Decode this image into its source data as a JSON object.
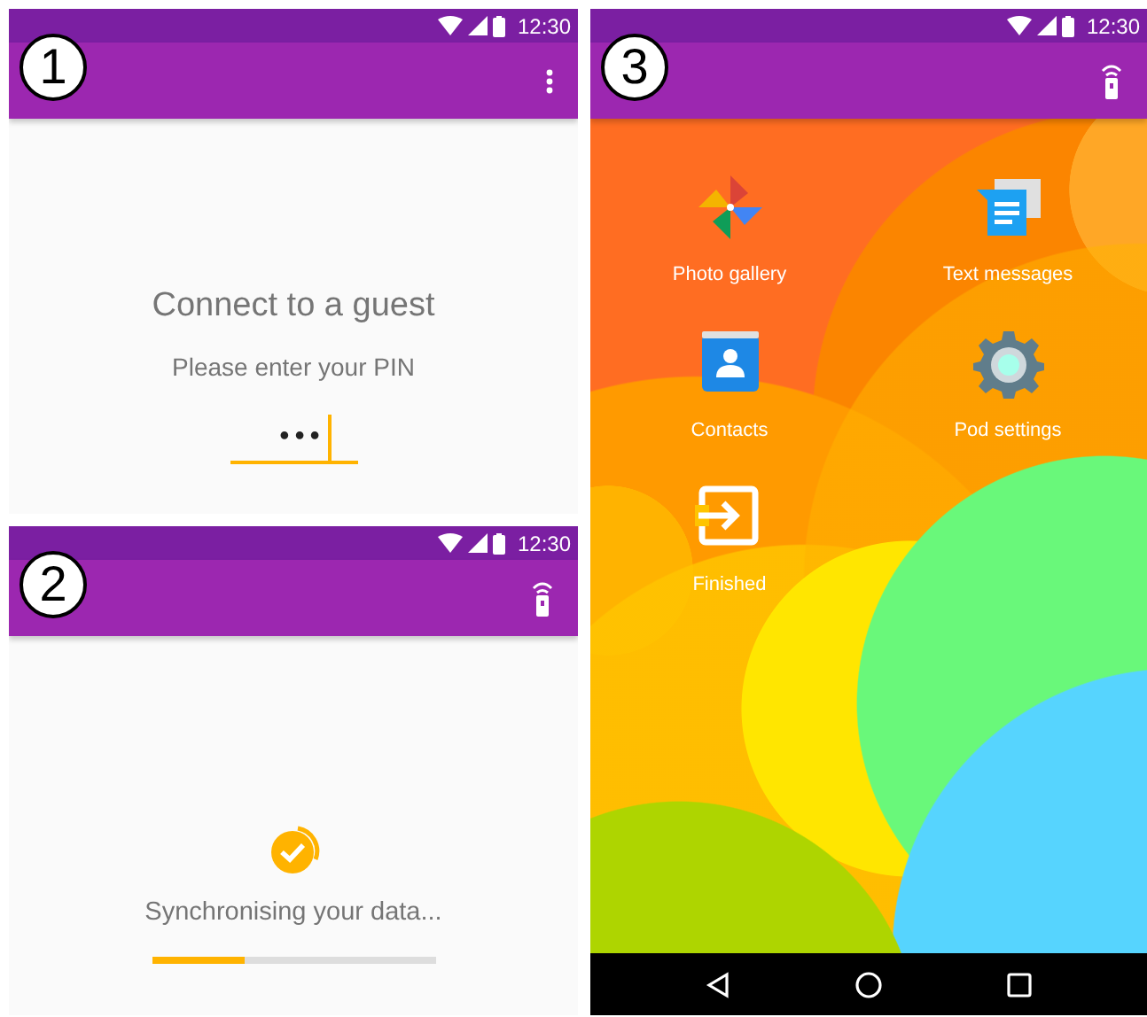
{
  "screens": [
    {
      "kind": "pin",
      "badge": "1",
      "status_bar": {
        "time": "12:30"
      },
      "app_bar": {
        "kind": "menu"
      },
      "title": "Connect to a guest",
      "subtitle": "Please enter your PIN",
      "pin_field": {
        "value": "•••"
      }
    },
    {
      "kind": "sync",
      "badge": "2",
      "status_bar": {
        "time": "12:30"
      },
      "app_bar": {
        "kind": "remote"
      },
      "message": "Synchronising your data...",
      "progress": {
        "level": 0.33
      }
    },
    {
      "kind": "home",
      "badge": "3",
      "status_bar": {
        "time": "12:30"
      },
      "app_bar": {
        "kind": "remote"
      },
      "apps": [
        {
          "label": "Photo gallery"
        },
        {
          "label": "Text messages"
        },
        {
          "label": "Contacts"
        },
        {
          "label": "Pod settings"
        },
        {
          "label": "Finished"
        }
      ]
    }
  ]
}
